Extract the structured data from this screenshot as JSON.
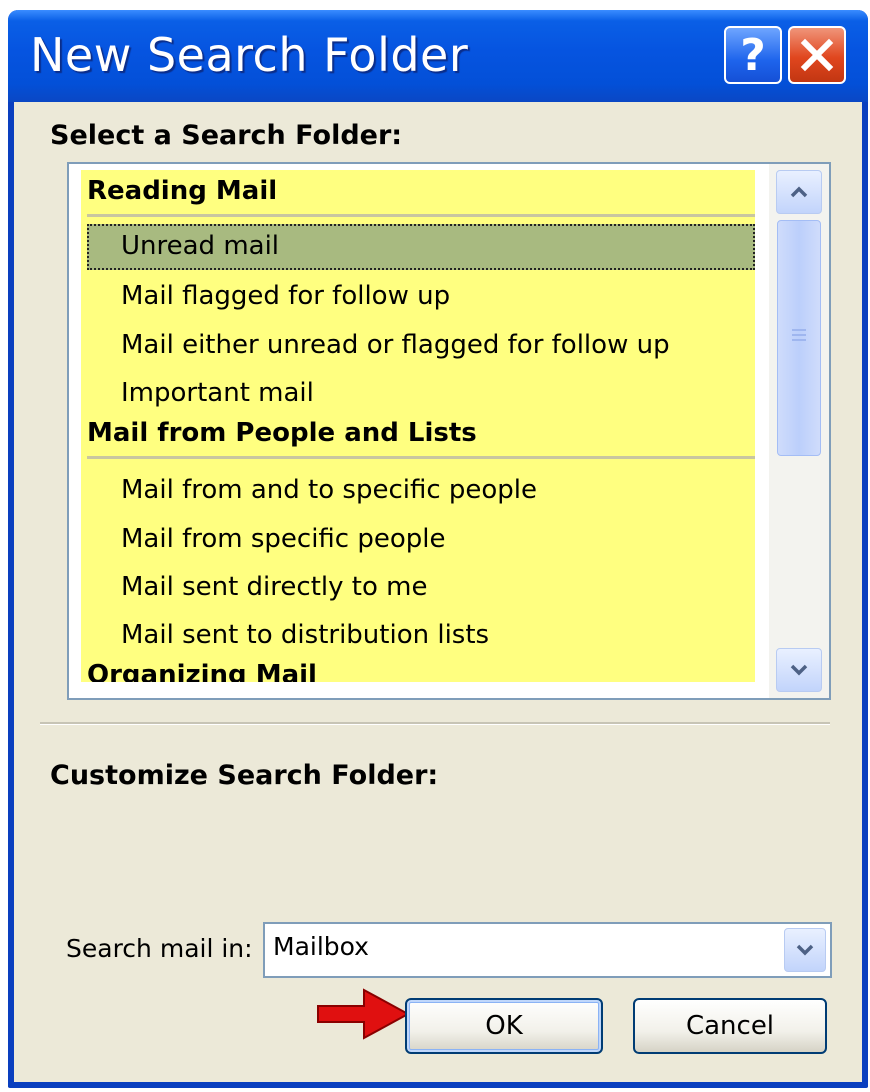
{
  "window": {
    "title": "New Search Folder",
    "help_glyph": "?"
  },
  "select_section": {
    "label": "Select a Search Folder:",
    "groups": [
      {
        "title": "Reading Mail",
        "items": [
          "Unread mail",
          "Mail flagged for follow up",
          "Mail either unread or flagged for follow up",
          "Important mail"
        ]
      },
      {
        "title": "Mail from People and Lists",
        "items": [
          "Mail from and to specific people",
          "Mail from specific people",
          "Mail sent directly to me",
          "Mail sent to distribution lists"
        ]
      },
      {
        "title": "Organizing Mail",
        "items": []
      }
    ],
    "selected_item": "Unread mail"
  },
  "customize_section": {
    "label": "Customize Search Folder:"
  },
  "search_in": {
    "label": "Search mail in:",
    "value": "Mailbox"
  },
  "buttons": {
    "ok": "OK",
    "cancel": "Cancel"
  },
  "colors": {
    "list_background": "#ffff80",
    "selected_row": "#a8ba80",
    "titlebar": "#0654e0",
    "annotation_arrow": "#e01010"
  }
}
